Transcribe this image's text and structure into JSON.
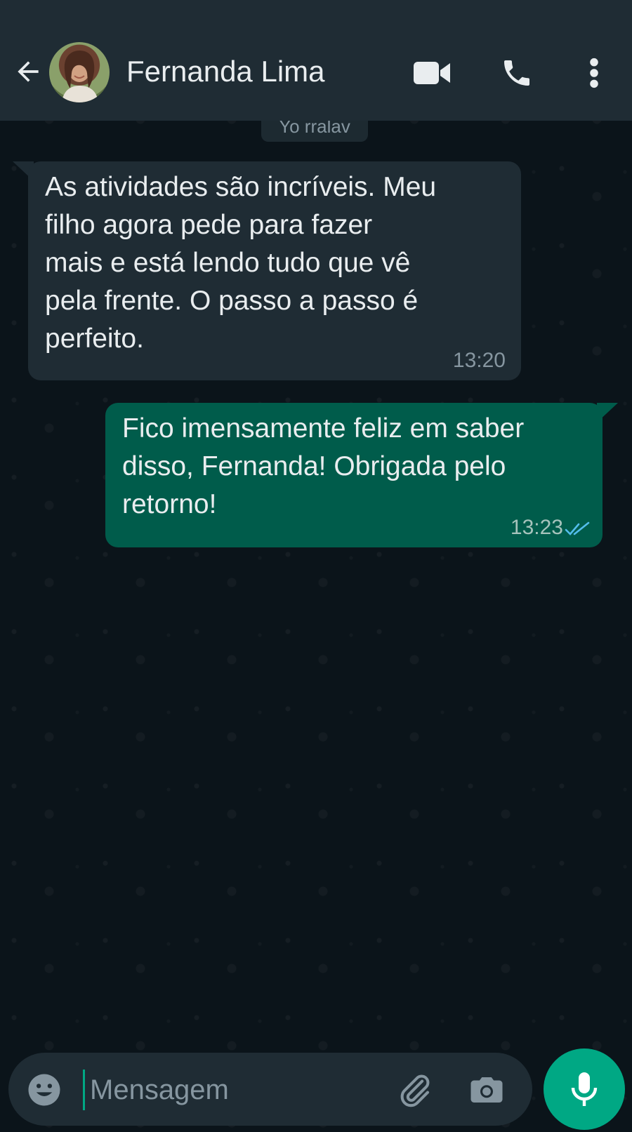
{
  "header": {
    "contact_name": "Fernanda Lima",
    "back_icon": "arrow-left-icon",
    "video_icon": "video-camera-icon",
    "call_icon": "phone-icon",
    "menu_icon": "more-vertical-icon"
  },
  "date_chip": "Yo rralav",
  "messages": [
    {
      "direction": "incoming",
      "text": "As atividades são incríveis. Meu\nfilho agora pede para fazer\nmais e está lendo tudo que vê\npela frente. O passo a passo é\nperfeito.",
      "time": "13:20"
    },
    {
      "direction": "outgoing",
      "text": "Fico imensamente feliz em saber\ndisso, Fernanda! Obrigada pelo\nretorno!",
      "time": "13:23",
      "status": "read"
    }
  ],
  "composer": {
    "placeholder": "Mensagem",
    "value": ""
  },
  "colors": {
    "header_bg": "#1f2c34",
    "chat_bg": "#0b141a",
    "incoming_bubble": "#1f2c34",
    "outgoing_bubble": "#005c4b",
    "accent": "#00a884",
    "read_ticks": "#53bdeb"
  }
}
